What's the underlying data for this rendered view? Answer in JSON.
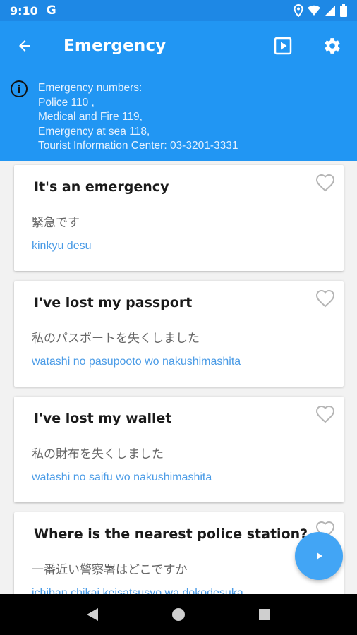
{
  "status_bar": {
    "time": "9:10",
    "carrier_icon": "G"
  },
  "app_bar": {
    "title": "Emergency"
  },
  "info": {
    "lines": [
      "Emergency numbers:",
      "Police 110 ,",
      "Medical and Fire 119,",
      "Emergency at sea 118,",
      "Tourist Information Center: 03-3201-3331"
    ]
  },
  "phrases": [
    {
      "english": "It's an emergency",
      "japanese": "緊急です",
      "romaji": "kinkyu desu"
    },
    {
      "english": "I've lost my passport",
      "japanese": "私のパスポートを失くしました",
      "romaji": "watashi no pasupooto wo nakushimashita"
    },
    {
      "english": "I've lost my wallet",
      "japanese": "私の財布を失くしました",
      "romaji": "watashi no saifu wo nakushimashita"
    },
    {
      "english": "Where is the nearest police station?",
      "japanese": "一番近い警察署はどこですか",
      "romaji": "ichiban chikai keisatsusyo wa dokodesuka"
    }
  ],
  "colors": {
    "primary": "#2196f3",
    "status": "#1e88e5",
    "romaji": "#4a9be6",
    "fab": "#42a5f5"
  },
  "icons": [
    "back-arrow-icon",
    "play-box-icon",
    "gear-icon",
    "info-icon",
    "heart-icon",
    "play-icon",
    "nav-back-icon",
    "nav-home-icon",
    "nav-recents-icon"
  ]
}
